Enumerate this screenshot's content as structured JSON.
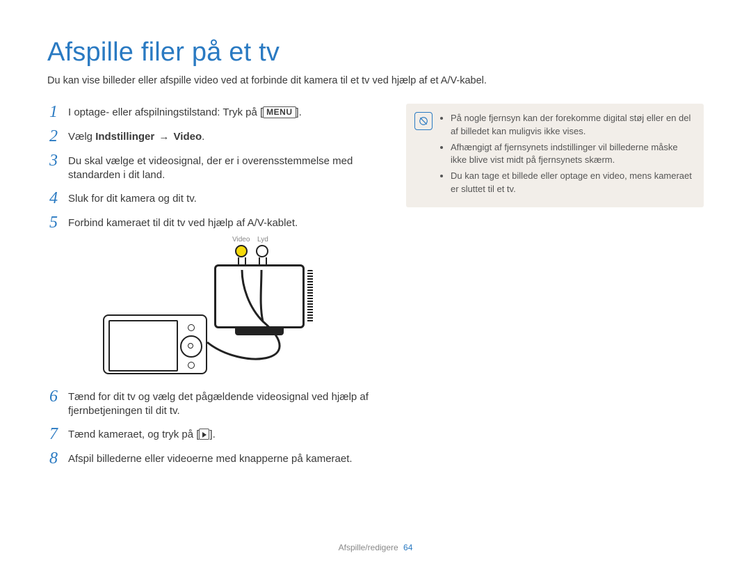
{
  "title": "Afspille filer på et tv",
  "intro": "Du kan vise billeder eller afspille video ved at forbinde dit kamera til et tv ved hjælp af et A/V-kabel.",
  "steps": [
    {
      "n": "1",
      "pre": "I optage- eller afspilningstilstand: Tryk på [",
      "token": "MENU",
      "post": "]."
    },
    {
      "n": "2",
      "pre": "Vælg ",
      "bold1": "Indstillinger",
      "arrow": " → ",
      "bold2": "Video",
      "post2": "."
    },
    {
      "n": "3",
      "text": "Du skal vælge et videosignal, der er i overensstemmelse med standarden i dit land."
    },
    {
      "n": "4",
      "text": "Sluk for dit kamera og dit tv."
    },
    {
      "n": "5",
      "text": "Forbind kameraet til dit tv ved hjælp af A/V-kablet."
    },
    {
      "n": "6",
      "text": "Tænd for dit tv og vælg det pågældende videosignal ved hjælp af fjernbetjeningen til dit tv."
    },
    {
      "n": "7",
      "pre": "Tænd kameraet, og tryk på [",
      "play": true,
      "post": "]."
    },
    {
      "n": "8",
      "text": "Afspil billederne eller videoerne med knapperne på kameraet."
    }
  ],
  "illus_labels": {
    "video": "Video",
    "audio": "Lyd"
  },
  "note": {
    "icon": "note-icon",
    "items": [
      "På nogle fjernsyn kan der forekomme digital støj eller en del af billedet kan muligvis ikke vises.",
      "Afhængigt af fjernsynets indstillinger vil billederne måske ikke blive vist midt på fjernsynets skærm.",
      "Du kan tage et billede eller optage en video, mens kameraet er sluttet til et tv."
    ]
  },
  "footer": {
    "section": "Afspille/redigere",
    "page": "64"
  }
}
